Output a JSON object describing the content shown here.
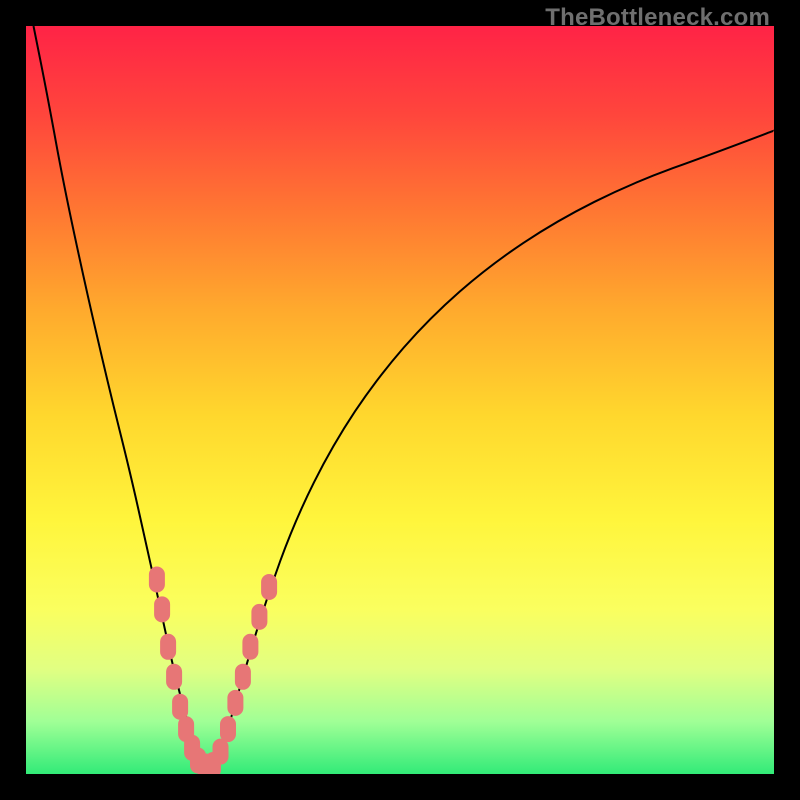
{
  "watermark": "TheBottleneck.com",
  "colors": {
    "page_bg": "#000000",
    "watermark_text": "#6f6f6f",
    "curve_stroke": "#000000",
    "dot_fill": "#e77676",
    "gradient_top": "#ff2346",
    "gradient_bottom": "#32eb78"
  },
  "chart_data": {
    "type": "line",
    "title": "",
    "xlabel": "",
    "ylabel": "",
    "xlim": [
      0,
      100
    ],
    "ylim": [
      0,
      100
    ],
    "grid": false,
    "series": [
      {
        "name": "bottleneck-curve",
        "x": [
          1,
          3,
          5,
          8,
          11,
          14,
          16,
          18,
          19.5,
          21,
          22.5,
          24,
          25.5,
          27,
          29,
          32,
          36,
          41,
          47,
          54,
          62,
          71,
          81,
          92,
          100
        ],
        "values": [
          100,
          90,
          79,
          65,
          52,
          40,
          31,
          22,
          15,
          9,
          4,
          1,
          2,
          6,
          13,
          23,
          34,
          44,
          53,
          61,
          68,
          74,
          79,
          83,
          86
        ]
      }
    ],
    "points": [
      {
        "name": "scatter-cluster",
        "x": 17.5,
        "y": 26
      },
      {
        "name": "scatter-cluster",
        "x": 18.2,
        "y": 22
      },
      {
        "name": "scatter-cluster",
        "x": 19.0,
        "y": 17
      },
      {
        "name": "scatter-cluster",
        "x": 19.8,
        "y": 13
      },
      {
        "name": "scatter-cluster",
        "x": 20.6,
        "y": 9
      },
      {
        "name": "scatter-cluster",
        "x": 21.4,
        "y": 6
      },
      {
        "name": "scatter-cluster",
        "x": 22.2,
        "y": 3.5
      },
      {
        "name": "scatter-cluster",
        "x": 23.0,
        "y": 1.8
      },
      {
        "name": "scatter-cluster",
        "x": 24.0,
        "y": 1
      },
      {
        "name": "scatter-cluster",
        "x": 25.0,
        "y": 1.2
      },
      {
        "name": "scatter-cluster",
        "x": 26.0,
        "y": 3
      },
      {
        "name": "scatter-cluster",
        "x": 27.0,
        "y": 6
      },
      {
        "name": "scatter-cluster",
        "x": 28.0,
        "y": 9.5
      },
      {
        "name": "scatter-cluster",
        "x": 29.0,
        "y": 13
      },
      {
        "name": "scatter-cluster",
        "x": 30.0,
        "y": 17
      },
      {
        "name": "scatter-cluster",
        "x": 31.2,
        "y": 21
      },
      {
        "name": "scatter-cluster",
        "x": 32.5,
        "y": 25
      }
    ]
  }
}
